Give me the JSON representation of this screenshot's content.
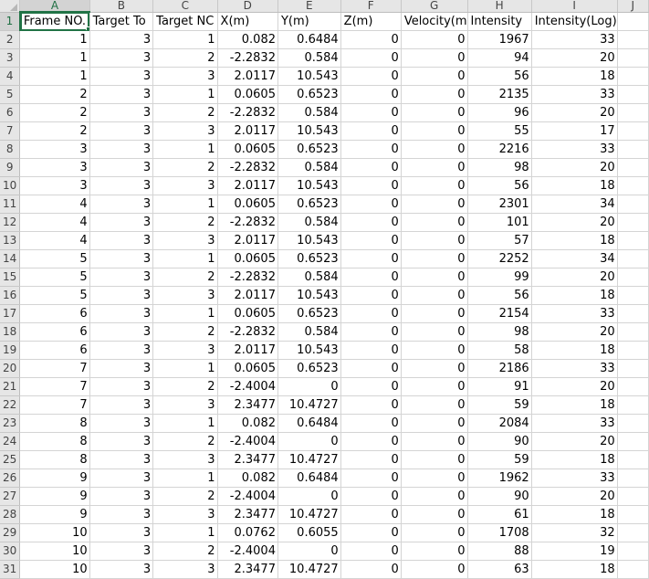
{
  "sheet": {
    "columns": [
      "A",
      "B",
      "C",
      "D",
      "E",
      "F",
      "G",
      "H",
      "I",
      "J"
    ],
    "selected_column": "A",
    "selected_row": 1,
    "headers": [
      "Frame NO.",
      "Target To",
      "Target NC",
      "X(m)",
      "Y(m)",
      "Z(m)",
      "Velocity(m",
      "Intensity",
      "Intensity(Log)",
      ""
    ],
    "rows": [
      [
        "1",
        "3",
        "1",
        "0.082",
        "0.6484",
        "0",
        "0",
        "1967",
        "33"
      ],
      [
        "1",
        "3",
        "2",
        "-2.2832",
        "0.584",
        "0",
        "0",
        "94",
        "20"
      ],
      [
        "1",
        "3",
        "3",
        "2.0117",
        "10.543",
        "0",
        "0",
        "56",
        "18"
      ],
      [
        "2",
        "3",
        "1",
        "0.0605",
        "0.6523",
        "0",
        "0",
        "2135",
        "33"
      ],
      [
        "2",
        "3",
        "2",
        "-2.2832",
        "0.584",
        "0",
        "0",
        "96",
        "20"
      ],
      [
        "2",
        "3",
        "3",
        "2.0117",
        "10.543",
        "0",
        "0",
        "55",
        "17"
      ],
      [
        "3",
        "3",
        "1",
        "0.0605",
        "0.6523",
        "0",
        "0",
        "2216",
        "33"
      ],
      [
        "3",
        "3",
        "2",
        "-2.2832",
        "0.584",
        "0",
        "0",
        "98",
        "20"
      ],
      [
        "3",
        "3",
        "3",
        "2.0117",
        "10.543",
        "0",
        "0",
        "56",
        "18"
      ],
      [
        "4",
        "3",
        "1",
        "0.0605",
        "0.6523",
        "0",
        "0",
        "2301",
        "34"
      ],
      [
        "4",
        "3",
        "2",
        "-2.2832",
        "0.584",
        "0",
        "0",
        "101",
        "20"
      ],
      [
        "4",
        "3",
        "3",
        "2.0117",
        "10.543",
        "0",
        "0",
        "57",
        "18"
      ],
      [
        "5",
        "3",
        "1",
        "0.0605",
        "0.6523",
        "0",
        "0",
        "2252",
        "34"
      ],
      [
        "5",
        "3",
        "2",
        "-2.2832",
        "0.584",
        "0",
        "0",
        "99",
        "20"
      ],
      [
        "5",
        "3",
        "3",
        "2.0117",
        "10.543",
        "0",
        "0",
        "56",
        "18"
      ],
      [
        "6",
        "3",
        "1",
        "0.0605",
        "0.6523",
        "0",
        "0",
        "2154",
        "33"
      ],
      [
        "6",
        "3",
        "2",
        "-2.2832",
        "0.584",
        "0",
        "0",
        "98",
        "20"
      ],
      [
        "6",
        "3",
        "3",
        "2.0117",
        "10.543",
        "0",
        "0",
        "58",
        "18"
      ],
      [
        "7",
        "3",
        "1",
        "0.0605",
        "0.6523",
        "0",
        "0",
        "2186",
        "33"
      ],
      [
        "7",
        "3",
        "2",
        "-2.4004",
        "0",
        "0",
        "0",
        "91",
        "20"
      ],
      [
        "7",
        "3",
        "3",
        "2.3477",
        "10.4727",
        "0",
        "0",
        "59",
        "18"
      ],
      [
        "8",
        "3",
        "1",
        "0.082",
        "0.6484",
        "0",
        "0",
        "2084",
        "33"
      ],
      [
        "8",
        "3",
        "2",
        "-2.4004",
        "0",
        "0",
        "0",
        "90",
        "20"
      ],
      [
        "8",
        "3",
        "3",
        "2.3477",
        "10.4727",
        "0",
        "0",
        "59",
        "18"
      ],
      [
        "9",
        "3",
        "1",
        "0.082",
        "0.6484",
        "0",
        "0",
        "1962",
        "33"
      ],
      [
        "9",
        "3",
        "2",
        "-2.4004",
        "0",
        "0",
        "0",
        "90",
        "20"
      ],
      [
        "9",
        "3",
        "3",
        "2.3477",
        "10.4727",
        "0",
        "0",
        "61",
        "18"
      ],
      [
        "10",
        "3",
        "1",
        "0.0762",
        "0.6055",
        "0",
        "0",
        "1708",
        "32"
      ],
      [
        "10",
        "3",
        "2",
        "-2.4004",
        "0",
        "0",
        "0",
        "88",
        "19"
      ],
      [
        "10",
        "3",
        "3",
        "2.3477",
        "10.4727",
        "0",
        "0",
        "63",
        "18"
      ]
    ],
    "colors": {
      "accent": "#217346",
      "header_bg": "#e6e6e6",
      "gridline": "#d4d4d4"
    }
  }
}
